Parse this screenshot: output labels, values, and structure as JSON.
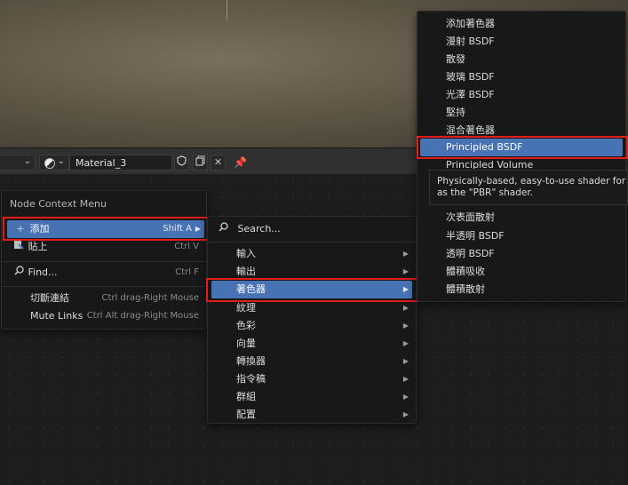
{
  "header": {
    "material_name": "Material_3"
  },
  "context_menu": {
    "title": "Node Context Menu",
    "items": [
      {
        "label": "添加",
        "shortcut": "Shift A"
      },
      {
        "label": "貼上",
        "shortcut": "Ctrl V"
      },
      {
        "label": "Find...",
        "shortcut": "Ctrl F"
      },
      {
        "label": "切斷連結",
        "shortcut": "Ctrl drag-Right Mouse"
      },
      {
        "label": "Mute Links",
        "shortcut": "Ctrl Alt drag-Right Mouse"
      }
    ]
  },
  "add_menu": {
    "search_label": "Search...",
    "items": [
      {
        "label": "輸入"
      },
      {
        "label": "輸出"
      },
      {
        "label": "著色器"
      },
      {
        "label": "紋理"
      },
      {
        "label": "色彩"
      },
      {
        "label": "向量"
      },
      {
        "label": "轉換器"
      },
      {
        "label": "指令稿"
      },
      {
        "label": "群組"
      },
      {
        "label": "配置"
      }
    ]
  },
  "shader_menu": {
    "items_top": [
      {
        "label": "添加著色器"
      },
      {
        "label": "漫射 BSDF"
      },
      {
        "label": "散發"
      },
      {
        "label": "玻璃 BSDF"
      },
      {
        "label": "光澤 BSDF"
      },
      {
        "label": "堅持"
      },
      {
        "label": "混合著色器"
      },
      {
        "label": "Principled BSDF"
      },
      {
        "label": "Principled Volume"
      }
    ],
    "items_bottom": [
      {
        "label": "次表面散射"
      },
      {
        "label": "半透明 BSDF"
      },
      {
        "label": "透明 BSDF"
      },
      {
        "label": "體積吸收"
      },
      {
        "label": "體積散射"
      }
    ]
  },
  "tooltip": {
    "line1": "Physically-based, easy-to-use shader for ren",
    "line2": "as the \"PBR\" shader."
  },
  "colors": {
    "highlight": "#4772b3",
    "annotation": "#e21b1b"
  }
}
